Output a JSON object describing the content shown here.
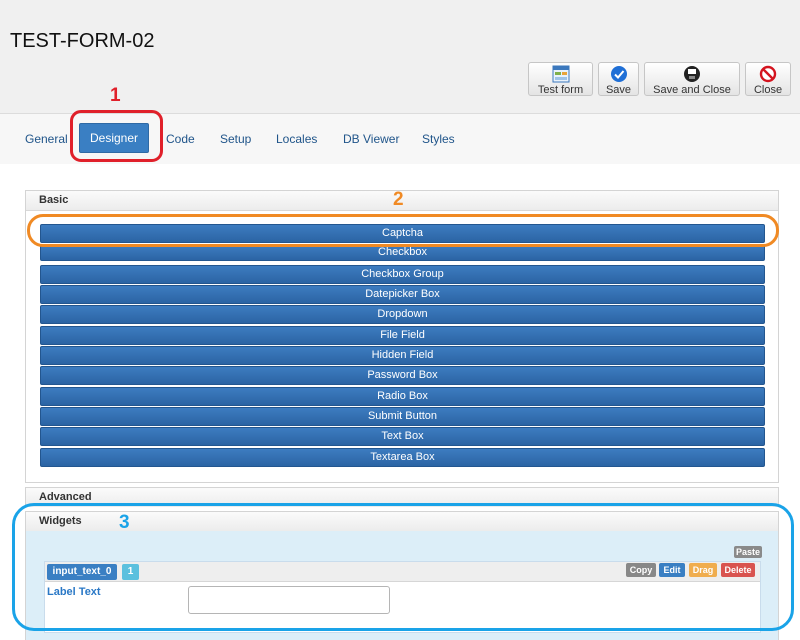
{
  "page": {
    "title": "TEST-FORM-02"
  },
  "toolbar": {
    "test_form_label": "Test form",
    "save_label": "Save",
    "save_close_label": "Save and Close",
    "close_label": "Close"
  },
  "tabs": {
    "general": "General",
    "designer": "Designer",
    "code": "Code",
    "setup": "Setup",
    "locales": "Locales",
    "db_viewer": "DB Viewer",
    "styles": "Styles"
  },
  "basic": {
    "title": "Basic",
    "items": [
      "Captcha",
      "Checkbox",
      "Checkbox Group",
      "Datepicker Box",
      "Dropdown",
      "File Field",
      "Hidden Field",
      "Password Box",
      "Radio Box",
      "Submit Button",
      "Text Box",
      "Textarea Box"
    ]
  },
  "advanced": {
    "title": "Advanced"
  },
  "widgets": {
    "title": "Widgets",
    "paste_label": "Paste",
    "field_name": "input_text_0",
    "field_count": "1",
    "copy_label": "Copy",
    "edit_label": "Edit",
    "drag_label": "Drag",
    "delete_label": "Delete",
    "label_text": "Label Text"
  },
  "annotations": {
    "one": "1",
    "two": "2",
    "three": "3"
  },
  "colors": {
    "accent_blue": "#3a7fc3",
    "annotation_red": "#e0202a",
    "annotation_orange": "#f08a24",
    "annotation_cyan": "#1aa3e8"
  }
}
